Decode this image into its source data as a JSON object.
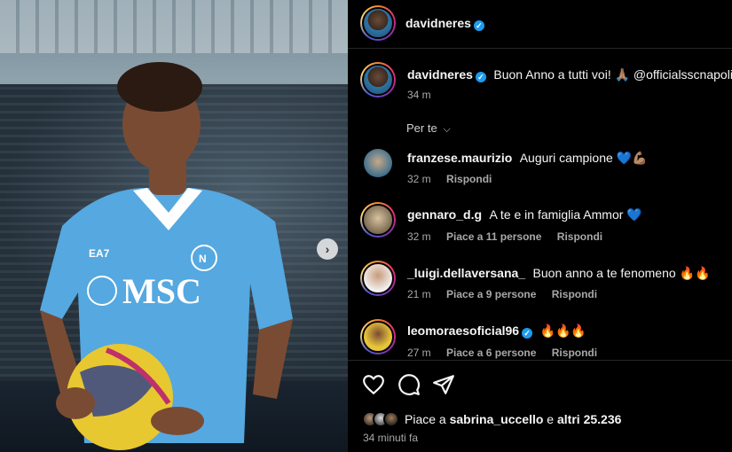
{
  "post": {
    "carousel_next_icon": "chevron-right-icon"
  },
  "header": {
    "username": "davidneres",
    "verified": true
  },
  "caption": {
    "username": "davidneres",
    "text": "Buon Anno a tutti voi! 🙏🏽 @officialsscnapoli",
    "time": "34 m"
  },
  "sort": {
    "label": "Per te"
  },
  "comments": [
    {
      "username": "franzese.maurizio",
      "text": "Auguri campione 💙💪🏽",
      "time": "32 m",
      "likes": "",
      "reply": "Rispondi"
    },
    {
      "username": "gennaro_d.g",
      "text": "A te e in famiglia Ammor 💙",
      "time": "32 m",
      "likes": "Piace a 11 persone",
      "reply": "Rispondi"
    },
    {
      "username": "_luigi.dellaversana_",
      "text": "Buon anno a te fenomeno 🔥🔥",
      "time": "21 m",
      "likes": "Piace a 9 persone",
      "reply": "Rispondi"
    },
    {
      "username": "leomoraesoficial96",
      "verified": true,
      "text": "🔥🔥🔥",
      "time": "27 m",
      "likes": "Piace a 6 persone",
      "reply": "Rispondi"
    }
  ],
  "footer": {
    "likes_prefix": "Piace a ",
    "likes_user": "sabrina_uccello",
    "likes_mid": " e ",
    "likes_others": "altri 25.236",
    "time": "34 minuti fa",
    "icons": [
      "heart-icon",
      "comment-icon",
      "share-icon"
    ]
  },
  "colors": {
    "background": "#000000",
    "verified": "#1d9bf0",
    "muted": "#a8a8a8"
  }
}
